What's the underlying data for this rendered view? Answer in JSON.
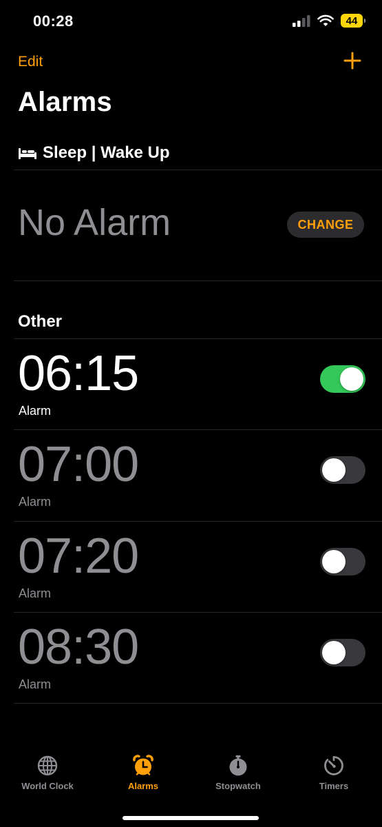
{
  "status_bar": {
    "time": "00:28",
    "battery": "44"
  },
  "header": {
    "edit_label": "Edit",
    "add_icon": "plus-icon",
    "title": "Alarms"
  },
  "sleep_section": {
    "icon": "bed-icon",
    "title": "Sleep | Wake Up",
    "value": "No Alarm",
    "change_label": "CHANGE"
  },
  "other_section": {
    "title": "Other"
  },
  "alarms": [
    {
      "time": "06:15",
      "label": "Alarm",
      "enabled": true
    },
    {
      "time": "07:00",
      "label": "Alarm",
      "enabled": false
    },
    {
      "time": "07:20",
      "label": "Alarm",
      "enabled": false
    },
    {
      "time": "08:30",
      "label": "Alarm",
      "enabled": false
    }
  ],
  "tabs": [
    {
      "label": "World Clock",
      "icon": "globe-icon",
      "active": false
    },
    {
      "label": "Alarms",
      "icon": "alarm-clock-icon",
      "active": true
    },
    {
      "label": "Stopwatch",
      "icon": "stopwatch-icon",
      "active": false
    },
    {
      "label": "Timers",
      "icon": "timer-icon",
      "active": false
    }
  ],
  "colors": {
    "accent": "#ff9f0a",
    "toggle_on": "#34c759",
    "toggle_off": "#39393d",
    "dim_text": "#8e8e93"
  }
}
